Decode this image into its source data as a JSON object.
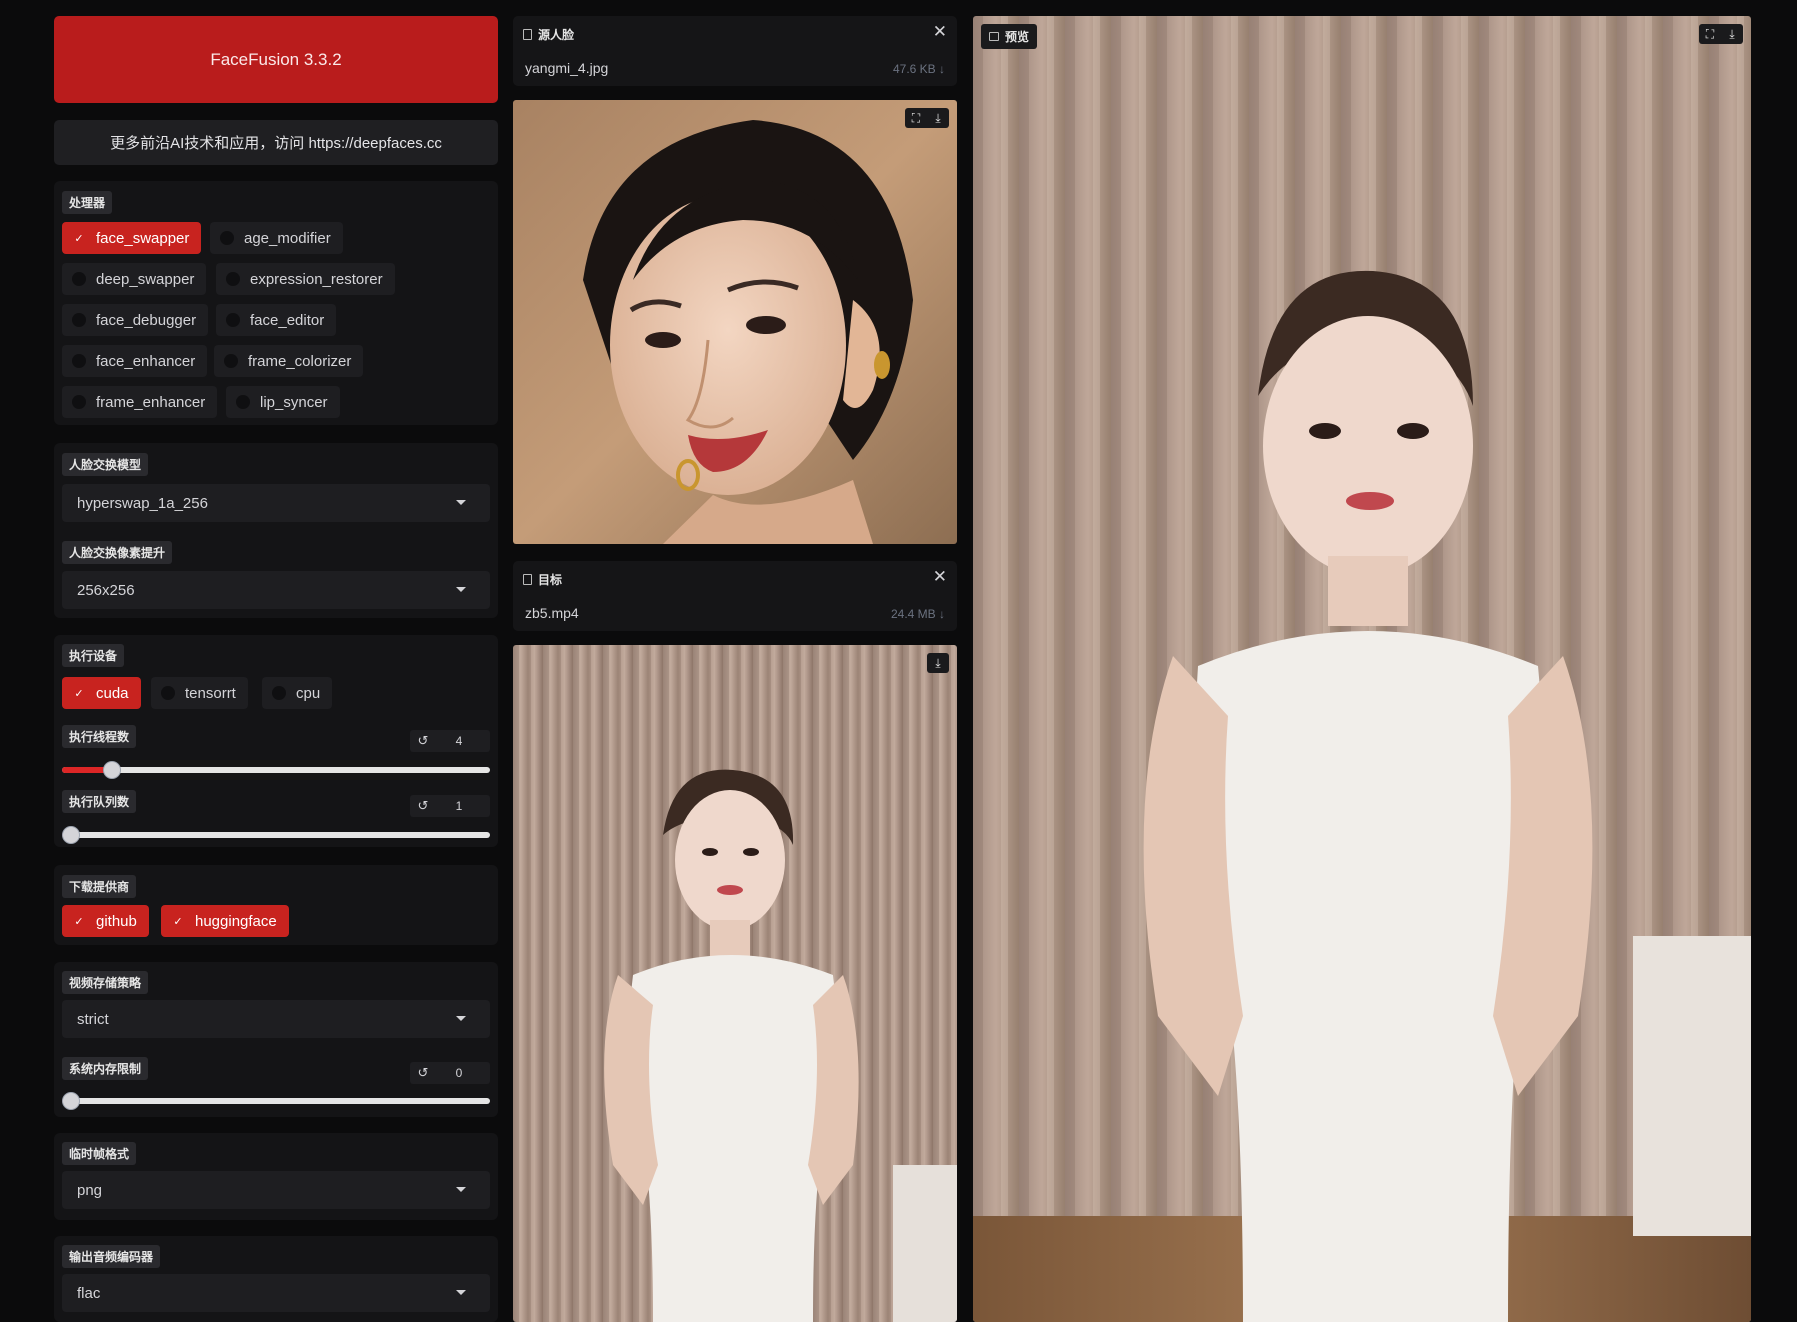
{
  "header": {
    "title": "FaceFusion 3.3.2",
    "info": "更多前沿AI技术和应用，访问 https://deepfaces.cc"
  },
  "processors": {
    "label": "处理器",
    "items": [
      {
        "label": "face_swapper",
        "checked": true
      },
      {
        "label": "age_modifier",
        "checked": false
      },
      {
        "label": "deep_swapper",
        "checked": false
      },
      {
        "label": "expression_restorer",
        "checked": false
      },
      {
        "label": "face_debugger",
        "checked": false
      },
      {
        "label": "face_editor",
        "checked": false
      },
      {
        "label": "face_enhancer",
        "checked": false
      },
      {
        "label": "frame_colorizer",
        "checked": false
      },
      {
        "label": "frame_enhancer",
        "checked": false
      },
      {
        "label": "lip_syncer",
        "checked": false
      }
    ]
  },
  "face_swap": {
    "model_label": "人脸交换模型",
    "model_value": "hyperswap_1a_256",
    "pixel_boost_label": "人脸交换像素提升",
    "pixel_boost_value": "256x256"
  },
  "execution": {
    "providers_label": "执行设备",
    "providers": [
      {
        "label": "cuda",
        "checked": true
      },
      {
        "label": "tensorrt",
        "checked": false
      },
      {
        "label": "cpu",
        "checked": false
      }
    ],
    "thread_label": "执行线程数",
    "thread_value": "4",
    "thread_level": 0.1,
    "queue_label": "执行队列数",
    "queue_value": "1",
    "queue_level": 0
  },
  "download": {
    "label": "下载提供商",
    "providers": [
      {
        "label": "github",
        "checked": true
      },
      {
        "label": "huggingface",
        "checked": true
      }
    ]
  },
  "memory": {
    "video_strategy_label": "视频存储策略",
    "video_strategy_value": "strict",
    "system_limit_label": "系统内存限制",
    "system_limit_value": "0",
    "system_limit_level": 0
  },
  "temp_frame": {
    "label": "临时帧格式",
    "value": "png"
  },
  "audio": {
    "label": "输出音频编码器",
    "value": "flac"
  },
  "source": {
    "label": "源人脸",
    "filename": "yangmi_4.jpg",
    "size": "47.6 KB ↓"
  },
  "target": {
    "label": "目标",
    "filename": "zb5.mp4",
    "size": "24.4 MB ↓"
  },
  "preview": {
    "label": "预览"
  },
  "icons": {
    "check": "✓",
    "close": "✕",
    "reset": "↺",
    "fullscreen": "⛶",
    "download": "⤓"
  },
  "colors": {
    "accent": "#c8231f",
    "background": "#0b0b0c",
    "panel": "#141416"
  }
}
